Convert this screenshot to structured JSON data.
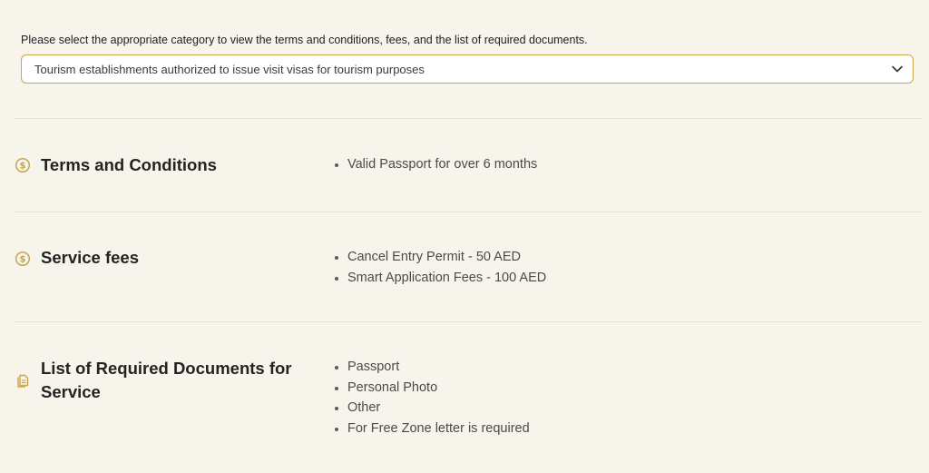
{
  "category_prompt": "Please select the appropriate category to view the terms and conditions, fees, and the list of required documents.",
  "category_select": {
    "selected": "Tourism establishments authorized to issue visit visas for tourism purposes",
    "icon": "chevron-down-icon"
  },
  "accent_color": "#c9a64a",
  "sections": {
    "terms": {
      "title": "Terms and Conditions",
      "icon": "dollar-circle-icon",
      "items": [
        "Valid Passport for over 6 months"
      ]
    },
    "fees": {
      "title": "Service fees",
      "icon": "dollar-circle-icon",
      "items": [
        "Cancel Entry Permit - 50 AED",
        "Smart Application Fees - 100 AED"
      ]
    },
    "documents": {
      "title": "List of Required Documents for Service",
      "icon": "document-icon",
      "items": [
        "Passport",
        "Personal Photo",
        "Other",
        "For Free Zone letter is required"
      ]
    }
  }
}
